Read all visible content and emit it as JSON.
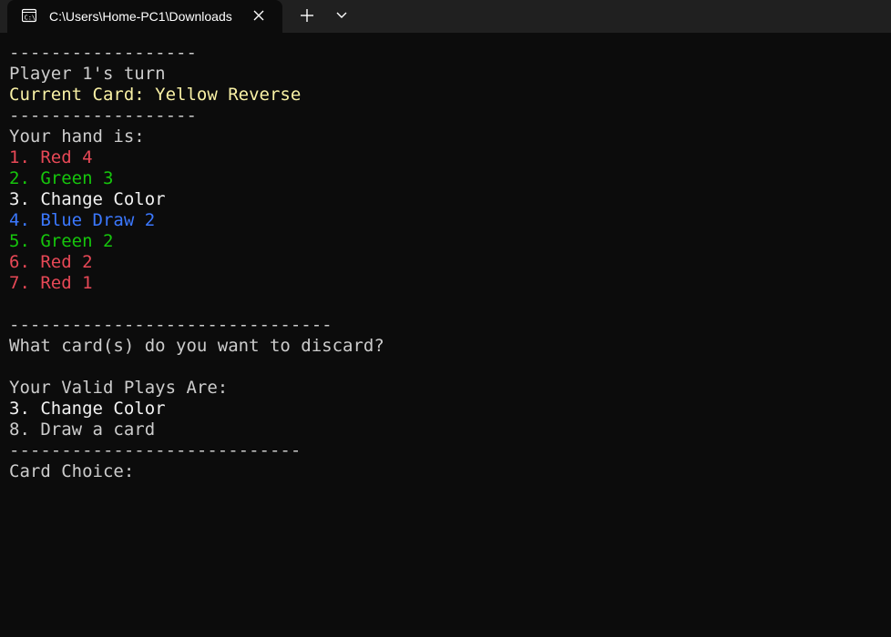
{
  "window": {
    "tab_title": "C:\\Users\\Home-PC1\\Downloads"
  },
  "console": {
    "lines": [
      {
        "text": "------------------",
        "color": "default"
      },
      {
        "text": "Player 1's turn",
        "color": "default"
      },
      {
        "text": "Current Card: Yellow Reverse",
        "color": "yellow"
      },
      {
        "text": "------------------",
        "color": "default"
      },
      {
        "text": "Your hand is:",
        "color": "default"
      },
      {
        "text": "1. Red 4",
        "color": "red"
      },
      {
        "text": "2. Green 3",
        "color": "green"
      },
      {
        "text": "3. Change Color",
        "color": "white"
      },
      {
        "text": "4. Blue Draw 2",
        "color": "blue"
      },
      {
        "text": "5. Green 2",
        "color": "green"
      },
      {
        "text": "6. Red 2",
        "color": "red"
      },
      {
        "text": "7. Red 1",
        "color": "red"
      },
      {
        "text": "",
        "color": "default"
      },
      {
        "text": "-------------------------------",
        "color": "default"
      },
      {
        "text": "What card(s) do you want to discard?",
        "color": "default"
      },
      {
        "text": "",
        "color": "default"
      },
      {
        "text": "Your Valid Plays Are:",
        "color": "default"
      },
      {
        "text": "3. Change Color",
        "color": "white"
      },
      {
        "text": "8. Draw a card",
        "color": "default"
      },
      {
        "text": "----------------------------",
        "color": "default"
      },
      {
        "text": "Card Choice: ",
        "color": "default"
      }
    ]
  },
  "colors": {
    "background": "#0c0c0c",
    "tabbar": "#202020",
    "default": "#cccccc",
    "yellow": "#f9f1a5",
    "red": "#e74856",
    "green": "#16c60c",
    "white": "#f2f2f2",
    "blue": "#3b78ff"
  }
}
